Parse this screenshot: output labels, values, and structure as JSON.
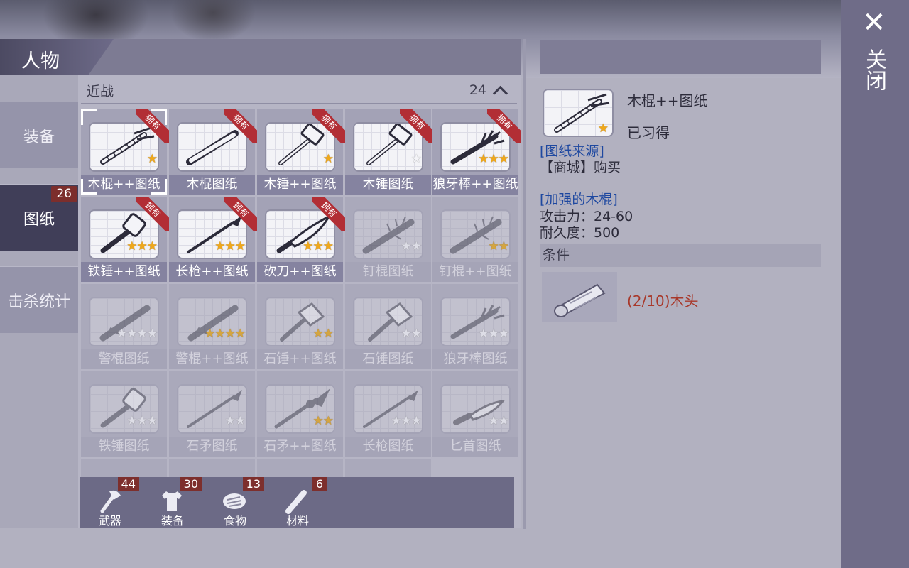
{
  "header": {
    "title": "人物"
  },
  "nav": {
    "items": [
      {
        "label": "装备"
      },
      {
        "label": "图纸",
        "badge": "26"
      },
      {
        "label": "击杀统计"
      }
    ]
  },
  "grid": {
    "category": "近战",
    "count": "24",
    "owned_tag": "拥有",
    "items": [
      {
        "label": "木棍++图纸",
        "stars": 1,
        "max_stars": 1,
        "owned": true,
        "icon": "club-wrapped"
      },
      {
        "label": "木棍图纸",
        "stars": 0,
        "max_stars": 0,
        "owned": true,
        "icon": "club"
      },
      {
        "label": "木锤++图纸",
        "stars": 1,
        "max_stars": 1,
        "owned": true,
        "icon": "hammer"
      },
      {
        "label": "木锤图纸",
        "stars": 0,
        "max_stars": 1,
        "owned": true,
        "icon": "hammer"
      },
      {
        "label": "狼牙棒++图纸",
        "stars": 3,
        "max_stars": 3,
        "owned": true,
        "icon": "spiked-club"
      },
      {
        "label": "铁锤++图纸",
        "stars": 3,
        "max_stars": 3,
        "owned": true,
        "icon": "sledge"
      },
      {
        "label": "长枪++图纸",
        "stars": 3,
        "max_stars": 3,
        "owned": true,
        "icon": "spear"
      },
      {
        "label": "砍刀++图纸",
        "stars": 3,
        "max_stars": 3,
        "owned": true,
        "icon": "machete"
      },
      {
        "label": "钉棍图纸",
        "stars": 0,
        "max_stars": 2,
        "owned": false,
        "icon": "nail-bat"
      },
      {
        "label": "钉棍++图纸",
        "stars": 2,
        "max_stars": 2,
        "owned": false,
        "icon": "nail-bat"
      },
      {
        "label": "警棍图纸",
        "stars": 0,
        "max_stars": 4,
        "owned": false,
        "icon": "baton"
      },
      {
        "label": "警棍++图纸",
        "stars": 4,
        "max_stars": 4,
        "owned": false,
        "icon": "baton"
      },
      {
        "label": "石锤++图纸",
        "stars": 2,
        "max_stars": 2,
        "owned": false,
        "icon": "stone-hammer"
      },
      {
        "label": "石锤图纸",
        "stars": 0,
        "max_stars": 2,
        "owned": false,
        "icon": "stone-hammer"
      },
      {
        "label": "狼牙棒图纸",
        "stars": 0,
        "max_stars": 3,
        "owned": false,
        "icon": "spiked-club"
      },
      {
        "label": "铁锤图纸",
        "stars": 0,
        "max_stars": 3,
        "owned": false,
        "icon": "sledge"
      },
      {
        "label": "石矛图纸",
        "stars": 0,
        "max_stars": 2,
        "owned": false,
        "icon": "spear"
      },
      {
        "label": "石矛++图纸",
        "stars": 2,
        "max_stars": 2,
        "owned": false,
        "icon": "spear-stone"
      },
      {
        "label": "长枪图纸",
        "stars": 0,
        "max_stars": 3,
        "owned": false,
        "icon": "spear"
      },
      {
        "label": "匕首图纸",
        "stars": 0,
        "max_stars": 2,
        "owned": false,
        "icon": "knife"
      }
    ]
  },
  "bottom_tabs": [
    {
      "label": "武器",
      "count": "44",
      "icon": "axe-icon"
    },
    {
      "label": "装备",
      "count": "30",
      "icon": "shirt-icon"
    },
    {
      "label": "食物",
      "count": "13",
      "icon": "meat-icon"
    },
    {
      "label": "材料",
      "count": "6",
      "icon": "wood-icon"
    }
  ],
  "detail": {
    "title": "木棍++图纸",
    "status": "已习得",
    "source_heading": "[图纸来源]",
    "source_text": "【商城】购买",
    "item_heading": "[加强的木棍]",
    "attack": "攻击力：24-60",
    "durability": "耐久度：500",
    "conditions_heading": "条件",
    "material": "(2/10)木头"
  },
  "close": {
    "label": "关闭",
    "x": "✕"
  },
  "colors": {
    "star": "#f0a81a",
    "ribbon": "#b22e35",
    "badge": "#7c2e2c",
    "active_nav": "#403e58",
    "link": "#1e48a0",
    "material": "#a8382a"
  }
}
